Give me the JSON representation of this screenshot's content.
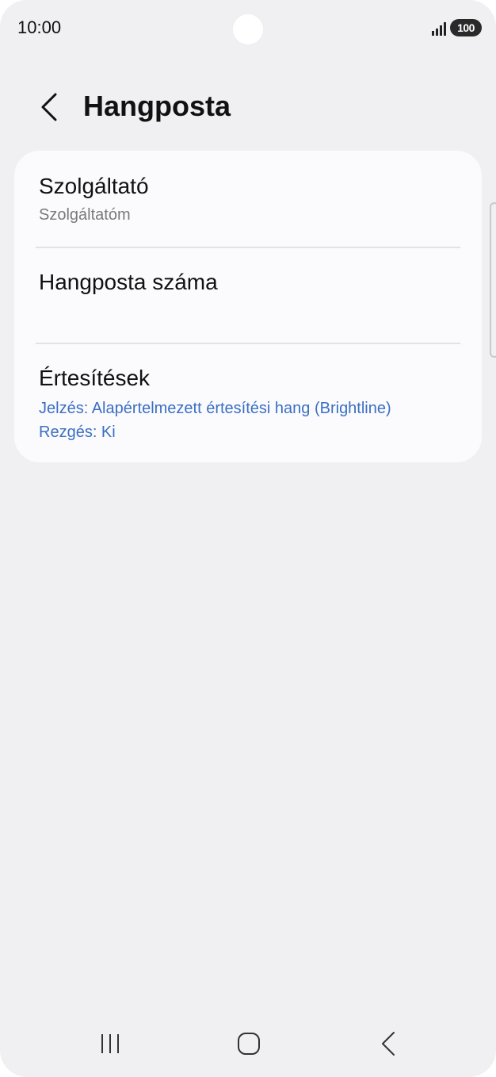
{
  "status_bar": {
    "time": "10:00",
    "battery": "100",
    "icons": [
      "signal-icon",
      "battery-icon"
    ]
  },
  "header": {
    "title": "Hangposta",
    "back_icon": "chevron-left-icon"
  },
  "settings": {
    "provider": {
      "title": "Szolgáltató",
      "value": "Szolgáltatóm"
    },
    "voicemail_number": {
      "title": "Hangposta száma"
    },
    "notifications": {
      "title": "Értesítések",
      "tone": "Jelzés: Alapértelmezett értesítési hang (Brightline)",
      "vibration": "Rezgés: Ki"
    }
  },
  "nav_bar": {
    "icons": [
      "recent-apps-icon",
      "home-icon",
      "back-icon"
    ]
  },
  "colors": {
    "background": "#f0f0f2",
    "card": "#fbfbfd",
    "accent_blue": "#3b6fc4",
    "text_primary": "#111111",
    "text_secondary": "#7a7a7a"
  }
}
